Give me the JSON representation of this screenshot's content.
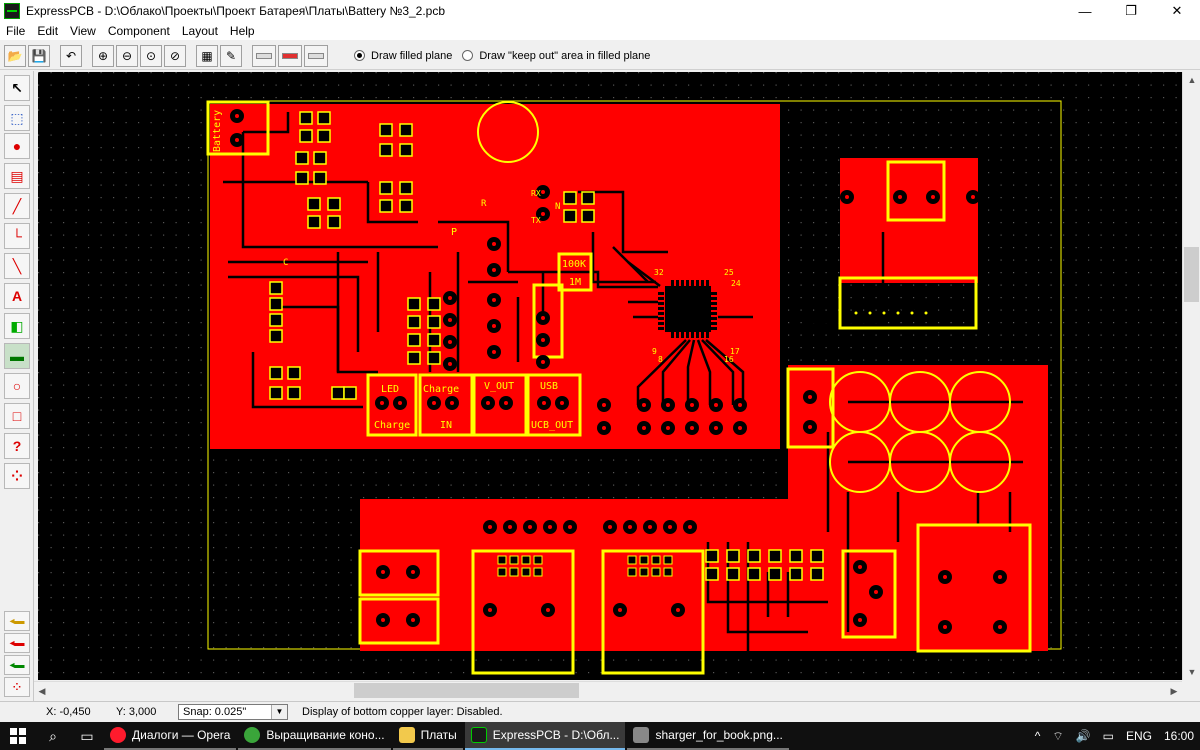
{
  "window": {
    "title": "ExpressPCB - D:\\Облако\\Проекты\\Проект Батарея\\Платы\\Battery №3_2.pcb",
    "minimize_glyph": "—",
    "maximize_glyph": "❐",
    "close_glyph": "✕"
  },
  "menu": [
    "File",
    "Edit",
    "View",
    "Component",
    "Layout",
    "Help"
  ],
  "toolbar": {
    "radio_filled_plane": "Draw filled plane",
    "radio_keepout": "Draw \"keep out\" area in filled plane",
    "selected": "Draw filled plane"
  },
  "palette_icons": [
    "pointer-icon",
    "zoom-select-icon",
    "pad-icon",
    "component-icon",
    "trace-icon",
    "trace-corner-icon",
    "line-icon",
    "text-icon",
    "layer-icon",
    "filled-plane-icon",
    "circle-icon",
    "rectangle-icon",
    "query-icon",
    "net-icon"
  ],
  "status": {
    "x": "X: -0,450",
    "y": "Y: 3,000",
    "snap": "Snap:  0.025\"",
    "message": "Display of bottom copper layer:  Disabled."
  },
  "pcb_labels": {
    "battery": "Battery",
    "led": "LED",
    "charge": "Charge",
    "v_out": "V_OUT",
    "usb": "USB",
    "charge2": "Charge",
    "in": "IN",
    "ucb_out": "UCB_OUT",
    "r100k": "100K",
    "m1": "1M",
    "rx": "RX",
    "tx": "TX",
    "n": "N",
    "p": "P",
    "n32": "32",
    "n25": "25",
    "n24": "24",
    "n17": "17",
    "n16": "16",
    "n9": "9",
    "n8": "8",
    "r_letter": "R",
    "c_letter": "C"
  },
  "colors": {
    "copper": "#ff0000",
    "silk": "#ffff00",
    "background": "#000000",
    "trace": "#000000"
  },
  "taskbar": {
    "tasks": [
      {
        "label": "Диалоги — Opera",
        "icon_color": "#ff1b2d",
        "active": false
      },
      {
        "label": "Выращивание коно...",
        "icon_color": "#3aa53a",
        "active": false
      },
      {
        "label": "Платы",
        "icon_color": "#f2c94c",
        "active": false
      },
      {
        "label": "ExpressPCB - D:\\Обл...",
        "icon_color": "#1a1a1a",
        "active": true
      },
      {
        "label": "sharger_for_book.png...",
        "icon_color": "#888888",
        "active": false
      }
    ],
    "tray_up": "^",
    "tray_lang": "ENG",
    "clock": "16:00"
  }
}
